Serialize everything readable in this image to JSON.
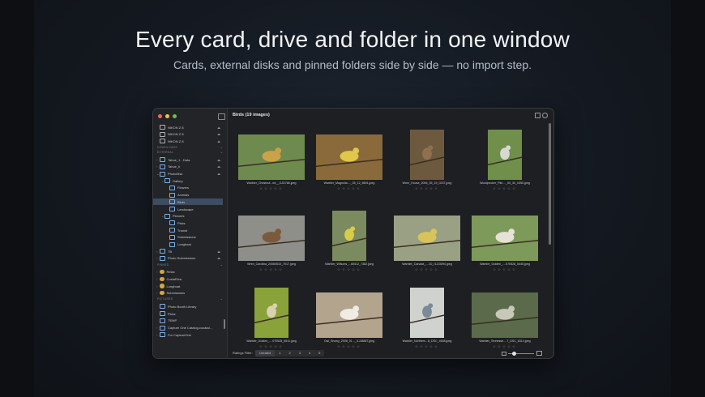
{
  "hero": {
    "title": "Every card, drive and folder in one window",
    "subtitle": "Cards, external disks and pinned folders side by side — no import step."
  },
  "sidebar": {
    "cameras": [
      "NIKON Z 8",
      "NIKON Z 8",
      "NIKON Z 8"
    ],
    "section_downloads": "DOWNLOADS",
    "section_external": "EXTERNAL",
    "external_items": [
      {
        "label": "Tahoe_1 - Data",
        "indent": 1,
        "chevron": "›"
      },
      {
        "label": "Tahoe_ii",
        "indent": 1,
        "chevron": "›"
      },
      {
        "label": "PhotoDisk",
        "indent": 1,
        "chevron": "⌄"
      },
      {
        "label": "Gallery",
        "indent": 2,
        "chevron": "⌄"
      },
      {
        "label": "Flowers",
        "indent": 3,
        "chevron": ""
      },
      {
        "label": "Animals",
        "indent": 3,
        "chevron": ""
      },
      {
        "label": "Birds",
        "indent": 3,
        "chevron": "",
        "selected": true
      },
      {
        "label": "Landscape",
        "indent": 3,
        "chevron": ""
      },
      {
        "label": "Pictures",
        "indent": 2,
        "chevron": "⌄"
      },
      {
        "label": "Picks",
        "indent": 3,
        "chevron": ""
      },
      {
        "label": "Transit",
        "indent": 3,
        "chevron": ""
      },
      {
        "label": "Submissions",
        "indent": 3,
        "chevron": ""
      },
      {
        "label": "Longboat",
        "indent": 3,
        "chevron": ""
      },
      {
        "label": "TB",
        "indent": 1,
        "chevron": "›"
      },
      {
        "label": "Photo Submissions",
        "indent": 1,
        "chevron": "›"
      }
    ],
    "section_pinned": "PINNED",
    "pinned_items": [
      "Relax",
      "CostaRica",
      "Longboat",
      "Submissions"
    ],
    "section_pictures": "PICTURES",
    "pictures_items": [
      {
        "label": "Photo Booth Library",
        "chevron": ""
      },
      {
        "label": "Picks",
        "chevron": ""
      },
      {
        "label": "TEMP",
        "chevron": ""
      },
      {
        "label": "Capture One Catalog.cocatal...",
        "chevron": "›"
      },
      {
        "label": "For CaptureOne",
        "chevron": "›"
      }
    ]
  },
  "main": {
    "title": "Birds (19 images)",
    "images": [
      {
        "name": "Warbler_Chestnut...ed__/1JD786.jpeg",
        "bg": "#6f8a4e",
        "fg": "#c9a24a",
        "orient": "land"
      },
      {
        "name": "Warbler_Magnolia...._05_12_8691.jpeg",
        "bg": "#8a6a3a",
        "fg": "#e0c64a",
        "orient": "land"
      },
      {
        "name": "Wren_House_2006_05_15_0237.jpeg",
        "bg": "#6d5a3e",
        "fg": "#8e7150",
        "orient": "port"
      },
      {
        "name": "Woodpecker_Pile...._05_30_0355.jpeg",
        "bg": "#6f8f4a",
        "fg": "#d8d8d2",
        "orient": "port"
      },
      {
        "name": "Wren_Carolina_20060510_7017.jpeg",
        "bg": "#8f8f8a",
        "fg": "#7a5a3a",
        "orient": "land"
      },
      {
        "name": "Warbler_Wilsons_...60512_7382.jpeg",
        "bg": "#7c8a60",
        "fg": "#d8cc48",
        "orient": "port"
      },
      {
        "name": "Warbler_Canada_....10_/1JJ3094.jpeg",
        "bg": "#9aa084",
        "fg": "#d9c45a",
        "orient": "land"
      },
      {
        "name": "Warbler_Golden_....070528_5445.jpeg",
        "bg": "#7d9a5a",
        "fg": "#e6e2d6",
        "orient": "land"
      },
      {
        "name": "Warbler_Golden_....070528_5511.jpeg",
        "bg": "#8aa23a",
        "fg": "#d8d2b0",
        "orient": "port"
      },
      {
        "name": "Owl_Snowy_2008_01..._/1JJ8887.jpeg",
        "bg": "#b3a48e",
        "fg": "#f0ece4",
        "orient": "land"
      },
      {
        "name": "Warbler_Northern...8_DSC_4548.jpeg",
        "bg": "#cfd2cf",
        "fg": "#7a8a96",
        "orient": "port"
      },
      {
        "name": "Warbler_Tennesse....7_DSC_6314.jpeg",
        "bg": "#5a6a4a",
        "fg": "#c8c8b8",
        "orient": "land"
      }
    ],
    "stars": "☆☆☆☆☆"
  },
  "bottombar": {
    "ratings_label": "Ratings Filter:",
    "ratings": [
      "Unrated",
      "1",
      "2",
      "3",
      "4",
      "5"
    ],
    "zoom_value": 0.22
  },
  "colors": {
    "traffic_red": "#ed6a5e",
    "traffic_yellow": "#f5bf4f",
    "traffic_green": "#61c554",
    "selection": "#3d4d63"
  }
}
